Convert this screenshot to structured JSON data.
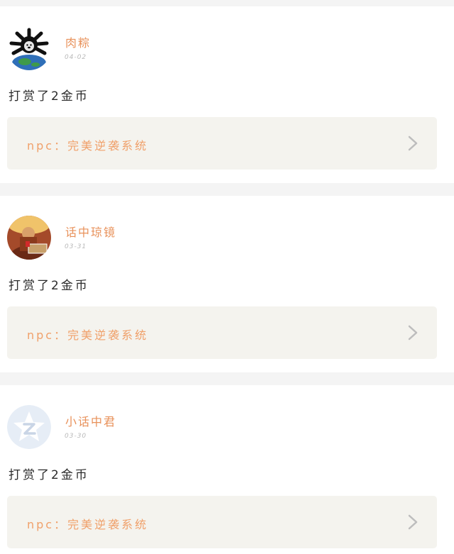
{
  "feed": {
    "items": [
      {
        "username": "肉粽",
        "date": "04-02",
        "message": "打赏了2金币",
        "book_label": "npc：完美逆袭系统",
        "avatar_icon": "bulldog-globe-avatar"
      },
      {
        "username": "话中琼镜",
        "date": "03-31",
        "message": "打赏了2金币",
        "book_label": "npc：完美逆袭系统",
        "avatar_icon": "monk-poster-avatar"
      },
      {
        "username": "小话中君",
        "date": "03-30",
        "message": "打赏了2金币",
        "book_label": "npc：完美逆袭系统",
        "avatar_icon": "default-z-star-avatar"
      }
    ]
  },
  "colors": {
    "accent": "#e8915a",
    "background": "#f4f4f4",
    "link_bg": "#f4f3ee"
  }
}
